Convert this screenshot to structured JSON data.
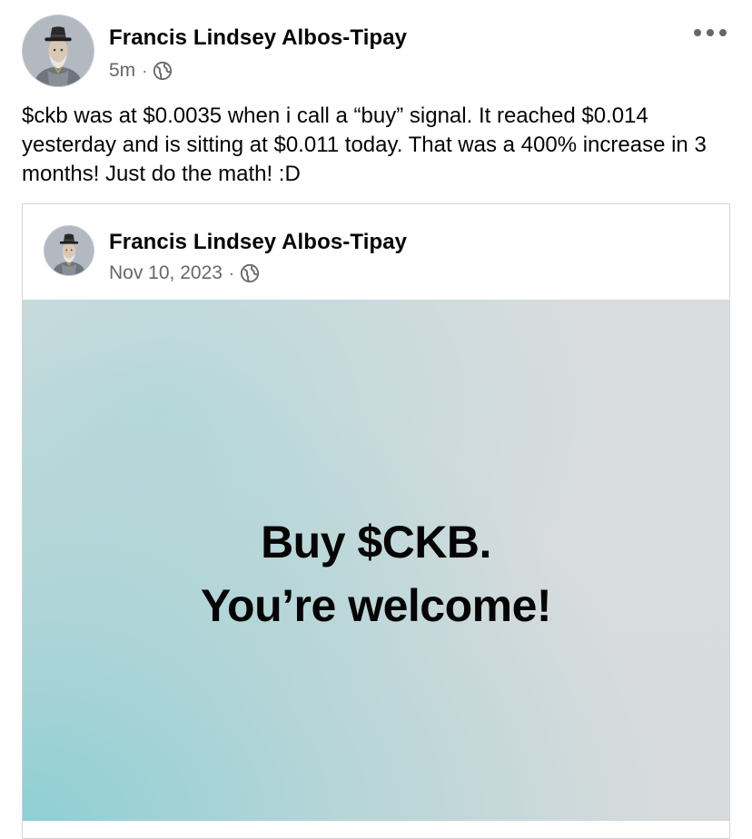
{
  "post": {
    "author": "Francis Lindsey Albos-Tipay",
    "time": "5m",
    "separator": "·",
    "privacy_icon": "globe-icon",
    "text": "$ckb was at $0.0035 when i call a “buy” signal. It reached $0.014 yesterday and is sitting at $0.011 today. That was a 400% increase in 3 months! Just do the math! :D",
    "more_icon": "more-horizontal-icon"
  },
  "shared_post": {
    "author": "Francis Lindsey Albos-Tipay",
    "date": "Nov 10, 2023",
    "separator": "·",
    "privacy_icon": "globe-icon",
    "image_text": {
      "line1": "Buy $CKB.",
      "line2": "You’re welcome!"
    }
  },
  "colors": {
    "primary_text": "#050505",
    "secondary_text": "#65676b",
    "card_border": "#d0d3d8",
    "image_teal": "#8aced4",
    "image_gray": "#d9dcde"
  }
}
